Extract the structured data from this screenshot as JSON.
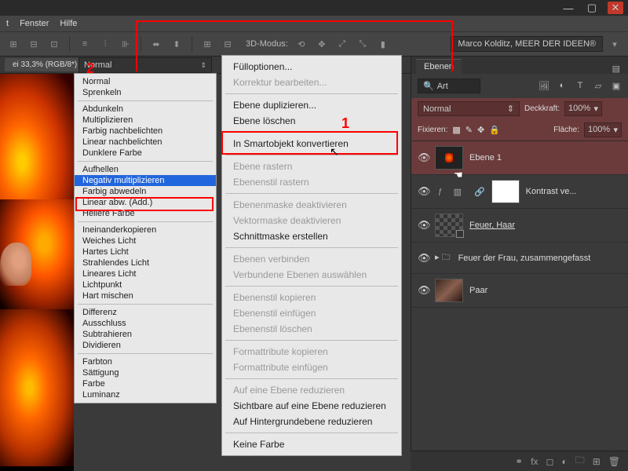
{
  "window": {
    "minimize": "—",
    "maximize": "▢",
    "close": "✕"
  },
  "menubar": {
    "items": [
      "t",
      "Fenster",
      "Hilfe"
    ]
  },
  "optbar": {
    "mode_label": "3D-Modus:",
    "user": "Marco Kolditz, MEER DER IDEEN®"
  },
  "doc": {
    "tab": "ei 33,3% (RGB/8*)"
  },
  "blend_dropdown": {
    "value": "Normal"
  },
  "blend_list": {
    "groups": [
      [
        "Normal",
        "Sprenkeln"
      ],
      [
        "Abdunkeln",
        "Multiplizieren",
        "Farbig nachbelichten",
        "Linear nachbelichten",
        "Dunklere Farbe"
      ],
      [
        "Aufhellen",
        "Negativ multiplizieren",
        "Farbig abwedeln",
        "Linear abw. (Add.)",
        "Hellere Farbe"
      ],
      [
        "Ineinanderkopieren",
        "Weiches Licht",
        "Hartes Licht",
        "Strahlendes Licht",
        "Lineares Licht",
        "Lichtpunkt",
        "Hart mischen"
      ],
      [
        "Differenz",
        "Ausschluss",
        "Subtrahieren",
        "Dividieren"
      ],
      [
        "Farbton",
        "Sättigung",
        "Farbe",
        "Luminanz"
      ]
    ],
    "selected": "Negativ multiplizieren"
  },
  "context_menu": {
    "sections": [
      [
        {
          "t": "Fülloptionen...",
          "d": false
        },
        {
          "t": "Korrektur bearbeiten...",
          "d": true
        }
      ],
      [
        {
          "t": "Ebene duplizieren...",
          "d": false
        },
        {
          "t": "Ebene löschen",
          "d": false
        }
      ],
      [
        {
          "t": "In Smartobjekt konvertieren",
          "d": false
        }
      ],
      [
        {
          "t": "Ebene rastern",
          "d": true
        },
        {
          "t": "Ebenenstil rastern",
          "d": true
        }
      ],
      [
        {
          "t": "Ebenenmaske deaktivieren",
          "d": true
        },
        {
          "t": "Vektormaske deaktivieren",
          "d": true
        },
        {
          "t": "Schnittmaske erstellen",
          "d": false
        }
      ],
      [
        {
          "t": "Ebenen verbinden",
          "d": true
        },
        {
          "t": "Verbundene Ebenen auswählen",
          "d": true
        }
      ],
      [
        {
          "t": "Ebenenstil kopieren",
          "d": true
        },
        {
          "t": "Ebenenstil einfügen",
          "d": true
        },
        {
          "t": "Ebenenstil löschen",
          "d": true
        }
      ],
      [
        {
          "t": "Formattribute kopieren",
          "d": true
        },
        {
          "t": "Formattribute einfügen",
          "d": true
        }
      ],
      [
        {
          "t": "Auf eine Ebene reduzieren",
          "d": true
        },
        {
          "t": "Sichtbare auf eine Ebene reduzieren",
          "d": false
        },
        {
          "t": "Auf Hintergrundebene reduzieren",
          "d": false
        }
      ],
      [
        {
          "t": "Keine Farbe",
          "d": false
        }
      ]
    ]
  },
  "annotations": {
    "one": "1",
    "two": "2"
  },
  "layers_panel": {
    "tab": "Ebenen",
    "search_placeholder": "Art",
    "blend_value": "Normal",
    "opacity_label": "Deckkraft:",
    "opacity_value": "100%",
    "lock_label": "Fixieren:",
    "fill_label": "Fläche:",
    "fill_value": "100%",
    "layers": [
      {
        "name": "Ebene 1",
        "sel": true,
        "thumb": "fire"
      },
      {
        "name": "Kontrast ve...",
        "sel": false,
        "thumb": "white",
        "fx": true
      },
      {
        "name": "Feuer, Haar",
        "sel": false,
        "thumb": "checker",
        "underline": true,
        "smart": true
      },
      {
        "name": "Feuer der Frau, zusammengefasst",
        "sel": false,
        "folder": true
      },
      {
        "name": "Paar",
        "sel": false,
        "thumb": "pair"
      }
    ]
  }
}
